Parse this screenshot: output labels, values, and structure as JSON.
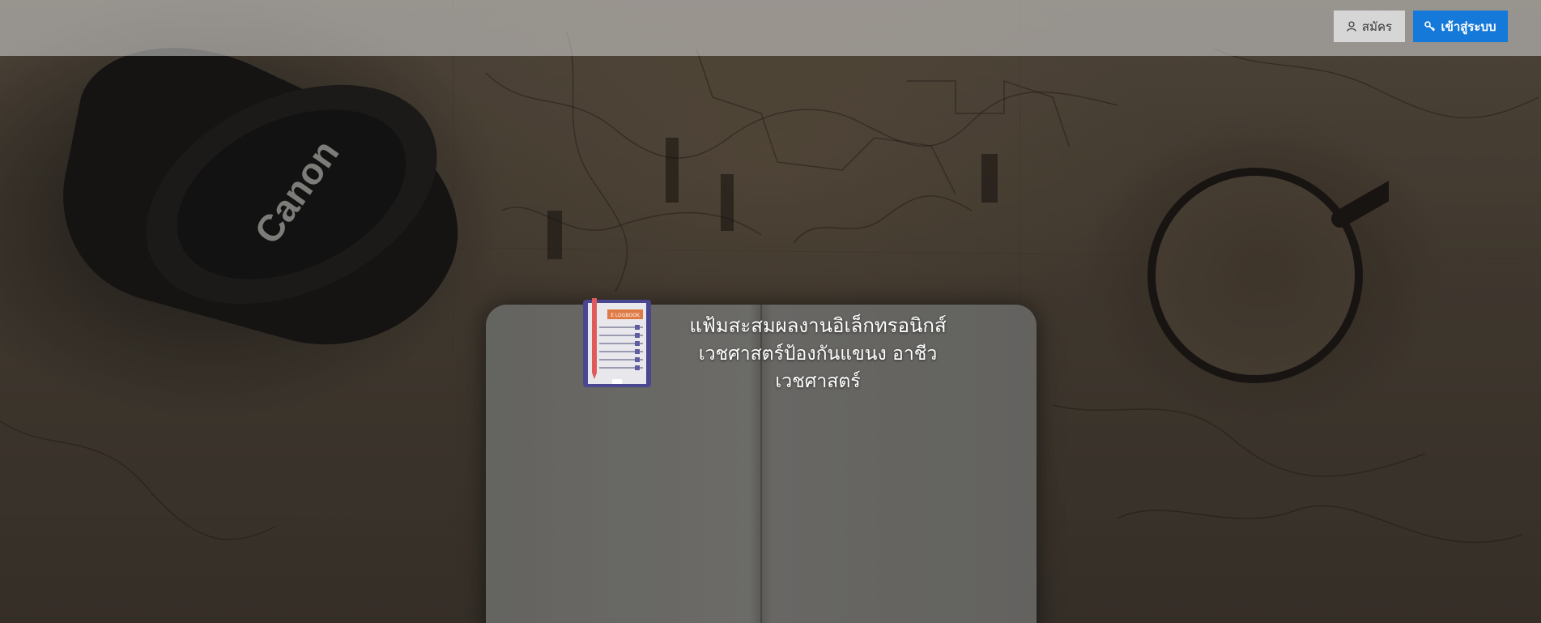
{
  "header": {
    "register_label": "สมัคร",
    "login_label": "เข้าสู่ระบบ",
    "register_icon": "user-icon",
    "login_icon": "key-icon"
  },
  "brand": {
    "logo_icon": "e-logbook-icon",
    "logo_text": "E LOGBOOK",
    "title_line1": "แฟ้มสะสมผลงานอิเล็กทรอนิกส์",
    "title_line2": "เวชศาสตร์ป้องกันแขนง อาชีวเวชศาสตร์"
  },
  "colors": {
    "login_button": "#1479d8",
    "register_button": "#d6d6d6",
    "topbar": "rgba(215,215,215,0.55)"
  }
}
